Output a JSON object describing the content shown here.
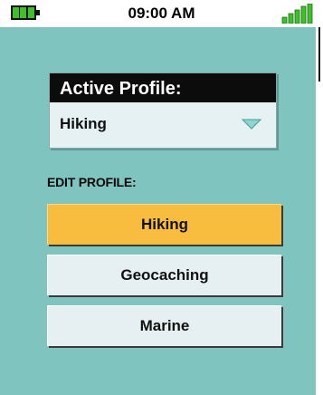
{
  "status": {
    "time": "09:00 AM",
    "battery_icon": "battery-full-icon",
    "signal_icon": "signal-strength-icon",
    "accent_green": "#3fbf2a"
  },
  "active_profile": {
    "header": "Active Profile:",
    "selected": "Hiking",
    "dropdown_icon": "chevron-down-icon"
  },
  "edit_profile": {
    "label": "EDIT PROFILE:",
    "buttons": [
      {
        "label": "Hiking",
        "active": true
      },
      {
        "label": "Geocaching",
        "active": false
      },
      {
        "label": "Marine",
        "active": false
      }
    ]
  },
  "colors": {
    "screen_bg": "#7fc4bf",
    "button_bg": "#e6f0f2",
    "button_active_bg": "#f8bd3f",
    "header_bg": "#0c0c0c"
  }
}
